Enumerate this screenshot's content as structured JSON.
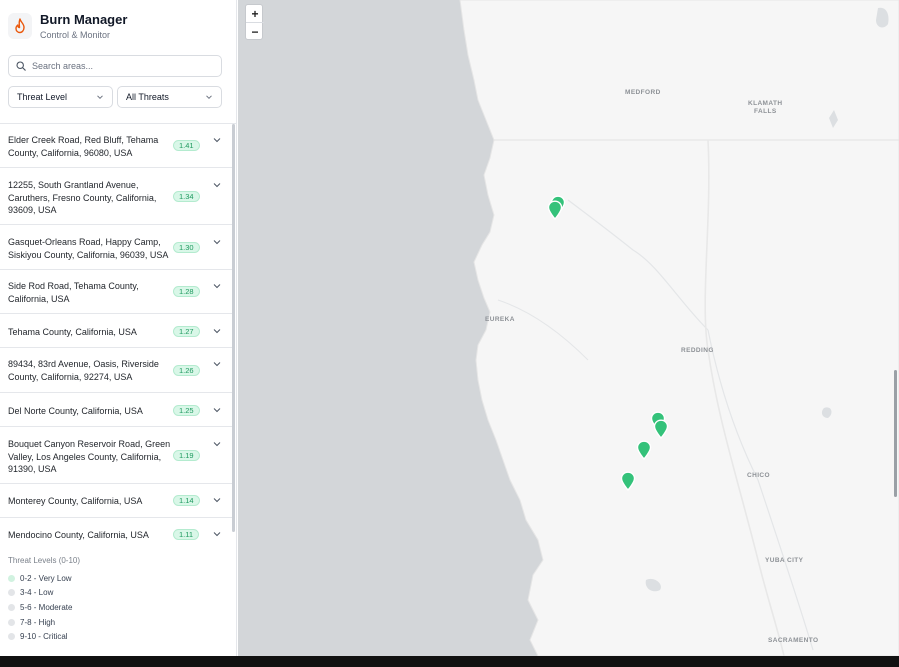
{
  "brand": {
    "title": "Burn Manager",
    "subtitle": "Control & Monitor",
    "logo_icon": "flame-icon",
    "accent": "#ea580c"
  },
  "search": {
    "placeholder": "Search areas...",
    "value": ""
  },
  "filters": {
    "threat_level": "Threat Level",
    "threat_type": "All Threats"
  },
  "areas": [
    {
      "title": "Elder Creek Road, Red Bluff, Tehama County, California, 96080, USA",
      "score": "1.41"
    },
    {
      "title": "12255, South Grantland Avenue, Caruthers, Fresno County, California, 93609, USA",
      "score": "1.34"
    },
    {
      "title": "Gasquet-Orleans Road, Happy Camp, Siskiyou County, California, 96039, USA",
      "score": "1.30"
    },
    {
      "title": "Side Rod Road, Tehama County, California, USA",
      "score": "1.28"
    },
    {
      "title": "Tehama County, California, USA",
      "score": "1.27"
    },
    {
      "title": "89434, 83rd Avenue, Oasis, Riverside County, California, 92274, USA",
      "score": "1.26"
    },
    {
      "title": "Del Norte County, California, USA",
      "score": "1.25"
    },
    {
      "title": "Bouquet Canyon Reservoir Road, Green Valley, Los Angeles County, California, 91390, USA",
      "score": "1.19"
    },
    {
      "title": "Monterey County, California, USA",
      "score": "1.14"
    },
    {
      "title": "Mendocino County, California, USA",
      "score": "1.11"
    }
  ],
  "legend": {
    "title": "Threat Levels (0-10)",
    "items": [
      {
        "label": "0-2 - Very Low",
        "color": "#d1f2e0"
      },
      {
        "label": "3-4 - Low",
        "color": "#e3e5e8"
      },
      {
        "label": "5-6 - Moderate",
        "color": "#e3e5e8"
      },
      {
        "label": "7-8 - High",
        "color": "#e3e5e8"
      },
      {
        "label": "9-10 - Critical",
        "color": "#e3e5e8"
      }
    ]
  },
  "map": {
    "zoom_in": "+",
    "zoom_out": "−",
    "cities": [
      "MEDFORD",
      "KLAMATH",
      "FALLS",
      "EUREKA",
      "REDDING",
      "CHICO",
      "YUBA CITY",
      "SACRAMENTO"
    ],
    "marker_color": "#34c27a"
  }
}
